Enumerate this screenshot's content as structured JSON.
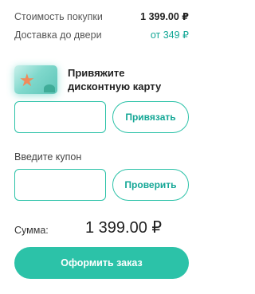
{
  "summary": {
    "purchase_label": "Стоимость покупки",
    "purchase_value": "1 399.00 ₽",
    "delivery_label": "Доставка до двери",
    "delivery_value": "от 349 ₽"
  },
  "discount_card": {
    "title_line1": "Привяжите",
    "title_line2": "дисконтную карту",
    "input_value": "",
    "button_label": "Привязать"
  },
  "coupon": {
    "label": "Введите купон",
    "input_value": "",
    "button_label": "Проверить"
  },
  "total": {
    "label": "Сумма:",
    "value": "1 399.00 ₽"
  },
  "checkout": {
    "button_label": "Оформить заказ"
  },
  "colors": {
    "accent": "#2cc2a8",
    "accent_text": "#14a796"
  },
  "icons": {
    "card_image": "discount-card-image"
  }
}
